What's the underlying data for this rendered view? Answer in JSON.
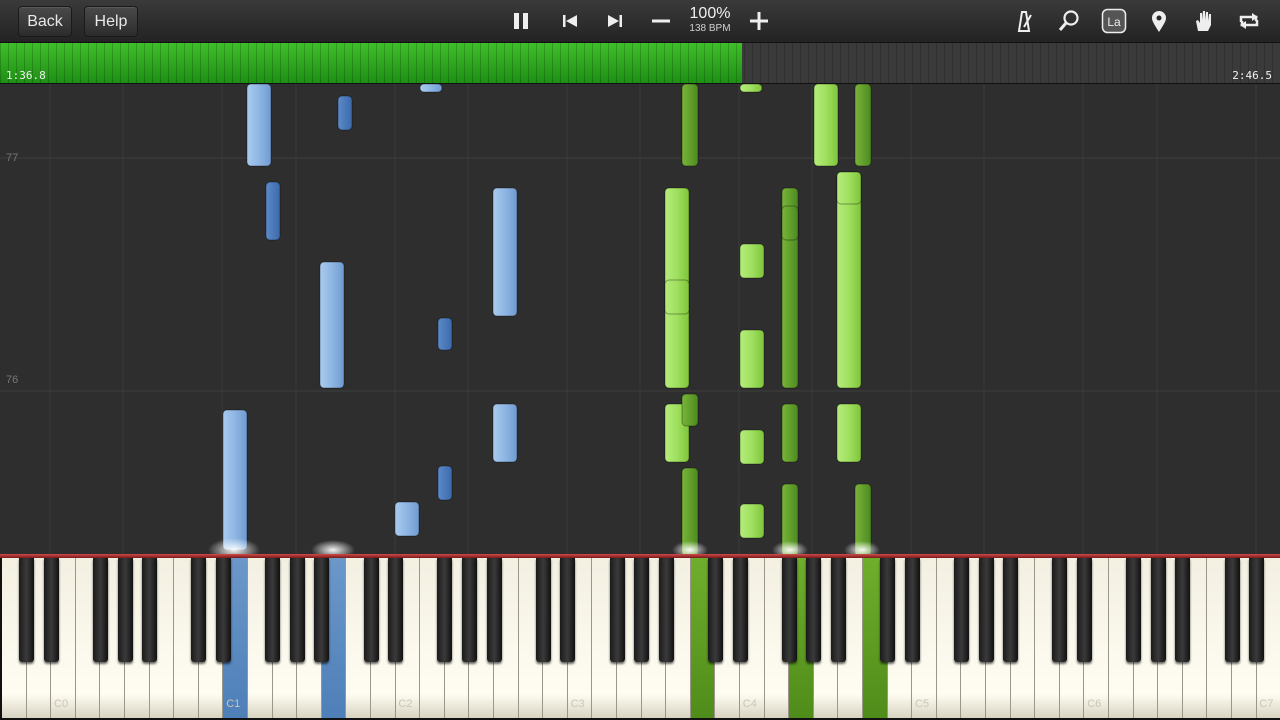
{
  "toolbar": {
    "back_label": "Back",
    "help_label": "Help",
    "tempo_percent": "100%",
    "tempo_bpm": "138 BPM",
    "icons": [
      "pause-icon",
      "skip-previous-icon",
      "skip-next-icon",
      "minus-icon",
      "plus-icon",
      "metronome-icon",
      "magnifier-icon",
      "note-labels-icon",
      "location-pin-icon",
      "hand-icon",
      "loop-icon"
    ],
    "note_label_text": "La"
  },
  "progress": {
    "elapsed": "1:36.8",
    "total": "2:46.5",
    "fraction": 0.58
  },
  "roll": {
    "measures": [
      "77",
      "76"
    ]
  },
  "keyboard": {
    "octave_labels": [
      "C0",
      "C1",
      "C2",
      "C3",
      "C4",
      "C5",
      "C6",
      "C7"
    ],
    "colors": {
      "left_hand": "#8fb6e3",
      "right_hand": "#9fe060",
      "left_dark": "#4a78b8",
      "right_dark": "#5a9c2a"
    }
  }
}
